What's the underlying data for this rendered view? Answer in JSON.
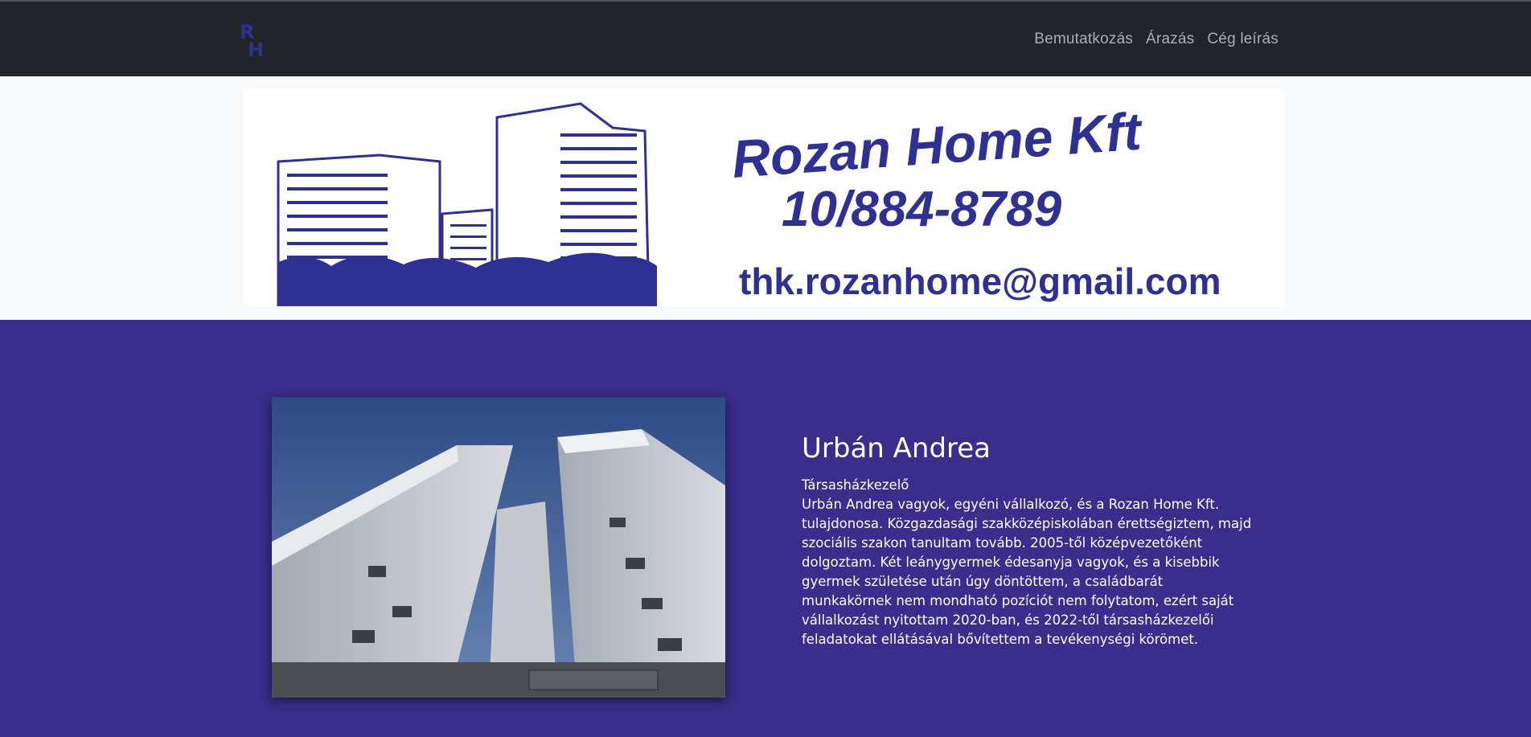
{
  "brand": {
    "logo_text": "RH"
  },
  "nav": {
    "links": [
      {
        "label": "Bemutatkozás"
      },
      {
        "label": "Árazás"
      },
      {
        "label": "Cég leírás"
      }
    ]
  },
  "banner": {
    "company": "Rozan Home Kft",
    "phone": "10/884-8789",
    "email": "thk.rozanhome@gmail.com"
  },
  "profile": {
    "name": "Urbán Andrea",
    "role": "Társasházkezelő",
    "bio": "Urbán Andrea vagyok, egyéni vállalkozó, és a Rozan Home Kft. tulajdonosa. Közgazdasági szakközépiskolában érettségiztem, majd szociális szakon tanultam tovább. 2005-től középvezetőként dolgoztam. Két leánygyermek édesanyja vagyok, és a kisebbik gyermek születése után úgy döntöttem, a családbarát munkakörnek nem mondható pozíciót nem folytatom, ezért saját vállalkozást nyitottam 2020-ban, és 2022-től társasházkezelői feladatokat ellátásával bővítettem a tevékenységi köröm­et."
  },
  "colors": {
    "navbar": "#212529",
    "content_bg": "#3a2d8b",
    "banner_ink": "#2e3192"
  }
}
